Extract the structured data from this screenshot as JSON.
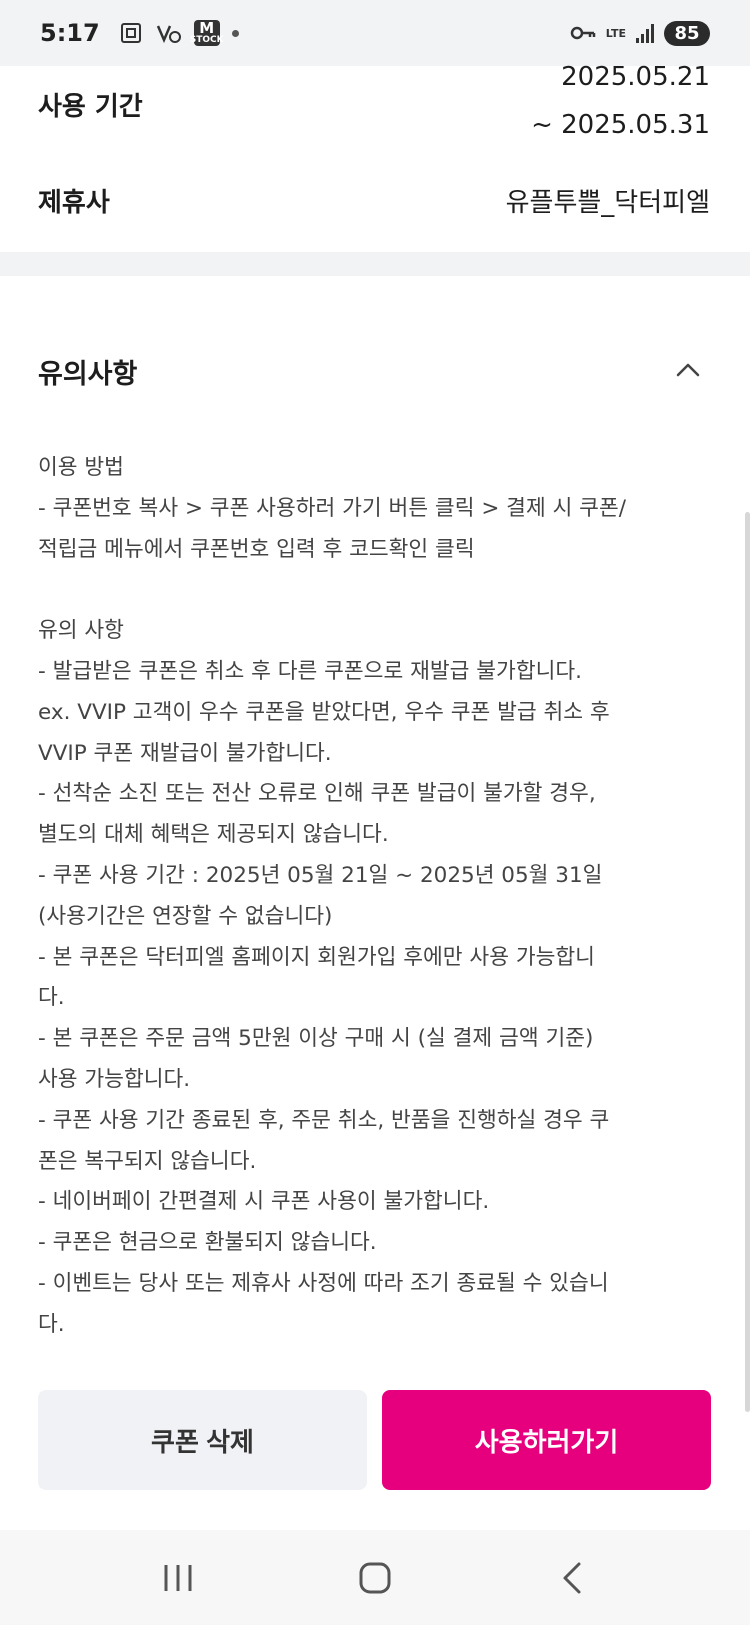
{
  "status_bar": {
    "time": "5:17",
    "stock_label": "M",
    "stock_sub": "STOCK",
    "lte": "LTE",
    "battery": "85"
  },
  "info": {
    "period_label": "사용 기간",
    "period_start": "2025.05.21",
    "period_end": "~ 2025.05.31",
    "partner_label": "제휴사",
    "partner_value": "유플투쁠_닥터피엘"
  },
  "notice": {
    "title": "유의사항",
    "body": "이용 방법\n- 쿠폰번호 복사 > 쿠폰 사용하러 가기 버튼 클릭 > 결제 시 쿠폰/\n적립금 메뉴에서 쿠폰번호 입력 후 코드확인 클릭\n\n유의 사항\n- 발급받은 쿠폰은 취소 후 다른 쿠폰으로 재발급 불가합니다.\nex. VVIP 고객이 우수 쿠폰을 받았다면, 우수 쿠폰 발급 취소 후\nVVIP 쿠폰 재발급이 불가합니다.\n- 선착순 소진 또는 전산 오류로 인해 쿠폰 발급이 불가할 경우,\n별도의 대체 혜택은 제공되지 않습니다.\n- 쿠폰 사용 기간 : 2025년 05월 21일 ~ 2025년 05월 31일\n(사용기간은 연장할 수 없습니다)\n- 본 쿠폰은 닥터피엘 홈페이지 회원가입 후에만 사용 가능합니\n다.\n- 본 쿠폰은 주문 금액 5만원 이상 구매 시 (실 결제 금액 기준)\n사용 가능합니다.\n- 쿠폰 사용 기간 종료된 후, 주문 취소, 반품을 진행하실 경우 쿠\n폰은 복구되지 않습니다.\n- 네이버페이 간편결제 시 쿠폰 사용이 불가합니다.\n- 쿠폰은 현금으로 환불되지 않습니다.\n- 이벤트는 당사 또는 제휴사 사정에 따라 조기 종료될 수 있습니\n다."
  },
  "buttons": {
    "delete_label": "쿠폰 삭제",
    "use_label": "사용하러가기"
  },
  "colors": {
    "accent": "#e6007e",
    "secondary_button": "#f1f2f5",
    "band": "#f2f3f5"
  }
}
